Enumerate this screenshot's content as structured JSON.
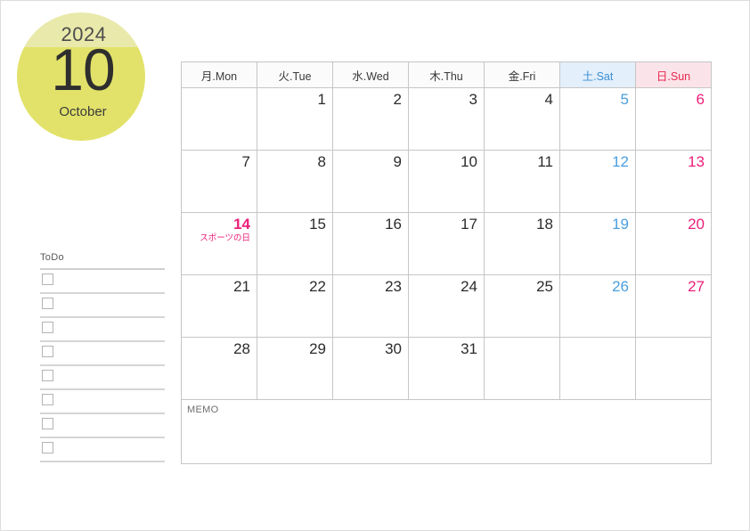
{
  "badge": {
    "year": "2024",
    "month_number": "10",
    "month_name": "October",
    "bg_top_color": "#e9e9ab",
    "bg_bottom_color": "#e2e26a"
  },
  "calendar": {
    "headers": [
      {
        "label": "月.Mon",
        "kind": "weekday"
      },
      {
        "label": "火.Tue",
        "kind": "weekday"
      },
      {
        "label": "水.Wed",
        "kind": "weekday"
      },
      {
        "label": "木.Thu",
        "kind": "weekday"
      },
      {
        "label": "金.Fri",
        "kind": "weekday"
      },
      {
        "label": "土.Sat",
        "kind": "saturday"
      },
      {
        "label": "日.Sun",
        "kind": "sunday"
      }
    ],
    "weeks": [
      [
        {
          "day": ""
        },
        {
          "day": "1"
        },
        {
          "day": "2"
        },
        {
          "day": "3"
        },
        {
          "day": "4"
        },
        {
          "day": "5",
          "kind": "saturday"
        },
        {
          "day": "6",
          "kind": "sunday"
        }
      ],
      [
        {
          "day": "7"
        },
        {
          "day": "8"
        },
        {
          "day": "9"
        },
        {
          "day": "10"
        },
        {
          "day": "11"
        },
        {
          "day": "12",
          "kind": "saturday"
        },
        {
          "day": "13",
          "kind": "sunday"
        }
      ],
      [
        {
          "day": "14",
          "kind": "holiday",
          "holiday": "スポーツの日"
        },
        {
          "day": "15"
        },
        {
          "day": "16"
        },
        {
          "day": "17"
        },
        {
          "day": "18"
        },
        {
          "day": "19",
          "kind": "saturday"
        },
        {
          "day": "20",
          "kind": "sunday"
        }
      ],
      [
        {
          "day": "21"
        },
        {
          "day": "22"
        },
        {
          "day": "23"
        },
        {
          "day": "24"
        },
        {
          "day": "25"
        },
        {
          "day": "26",
          "kind": "saturday"
        },
        {
          "day": "27",
          "kind": "sunday"
        }
      ],
      [
        {
          "day": "28"
        },
        {
          "day": "29"
        },
        {
          "day": "30"
        },
        {
          "day": "31"
        },
        {
          "day": ""
        },
        {
          "day": "",
          "kind": "saturday"
        },
        {
          "day": "",
          "kind": "sunday"
        }
      ]
    ],
    "memo_label": "MEMO",
    "colors": {
      "saturday_text": "#4a9ede",
      "sunday_text": "#ec1e79",
      "holiday_text": "#ec1e79",
      "saturday_header_bg": "#e3effa",
      "sunday_header_bg": "#fbe4e9",
      "grid_line": "#c6c6c6"
    }
  },
  "todo": {
    "title": "ToDo",
    "rows": [
      "",
      "",
      "",
      "",
      "",
      "",
      "",
      ""
    ]
  }
}
